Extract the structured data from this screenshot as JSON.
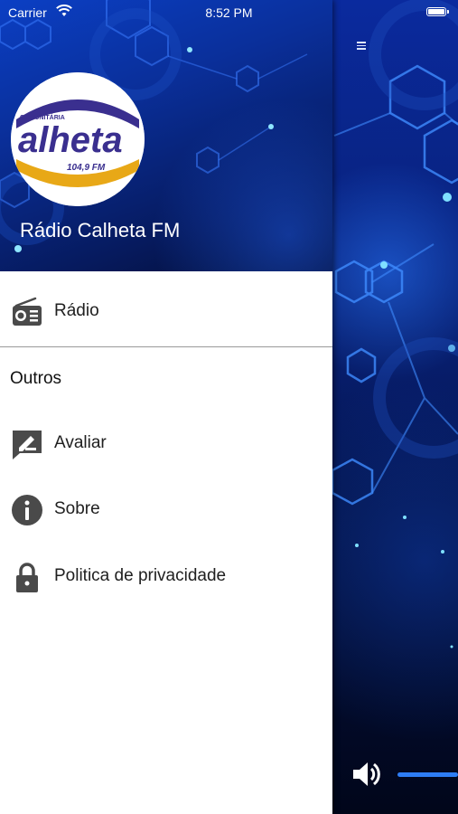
{
  "status_bar": {
    "carrier": "Carrier",
    "time": "8:52 PM"
  },
  "drawer": {
    "station_name": "Rádio Calheta FM",
    "logo": {
      "top_text": "COMUNITÁRIA",
      "brand": "alheta",
      "frequency": "104,9 FM"
    },
    "primary_items": [
      {
        "label": "Rádio",
        "icon": "radio-icon"
      }
    ],
    "section_title": "Outros",
    "other_items": [
      {
        "label": "Avaliar",
        "icon": "rate-icon"
      },
      {
        "label": "Sobre",
        "icon": "info-icon"
      },
      {
        "label": "Politica de privacidade",
        "icon": "lock-icon"
      }
    ]
  },
  "player": {
    "volume_level": 0.2
  },
  "colors": {
    "accent_blue": "#2e7df5",
    "logo_purple": "#3a2f8f",
    "logo_gold": "#e8a817",
    "icon_gray": "#4a4a4a"
  }
}
